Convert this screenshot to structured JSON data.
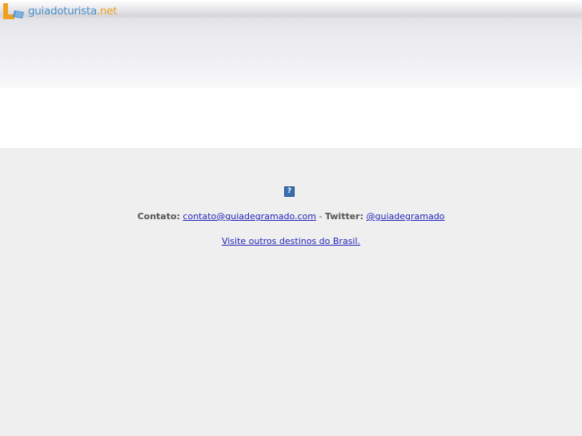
{
  "header": {
    "logo_main": "guiadoturista",
    "logo_tld": ".net"
  },
  "content": {
    "help_icon_glyph": "?",
    "contact_label": "Contato:",
    "contact_email": "contato@guiadegramado.com",
    "separator": "-",
    "twitter_label": "Twitter:",
    "twitter_handle": "@guiadegramado",
    "destinos_link": "Visite outros destinos do Brasil."
  },
  "colors": {
    "link": "#2323b8",
    "logo_blue": "#4a8fc9",
    "logo_orange": "#f0a020",
    "background": "#efeff0"
  }
}
